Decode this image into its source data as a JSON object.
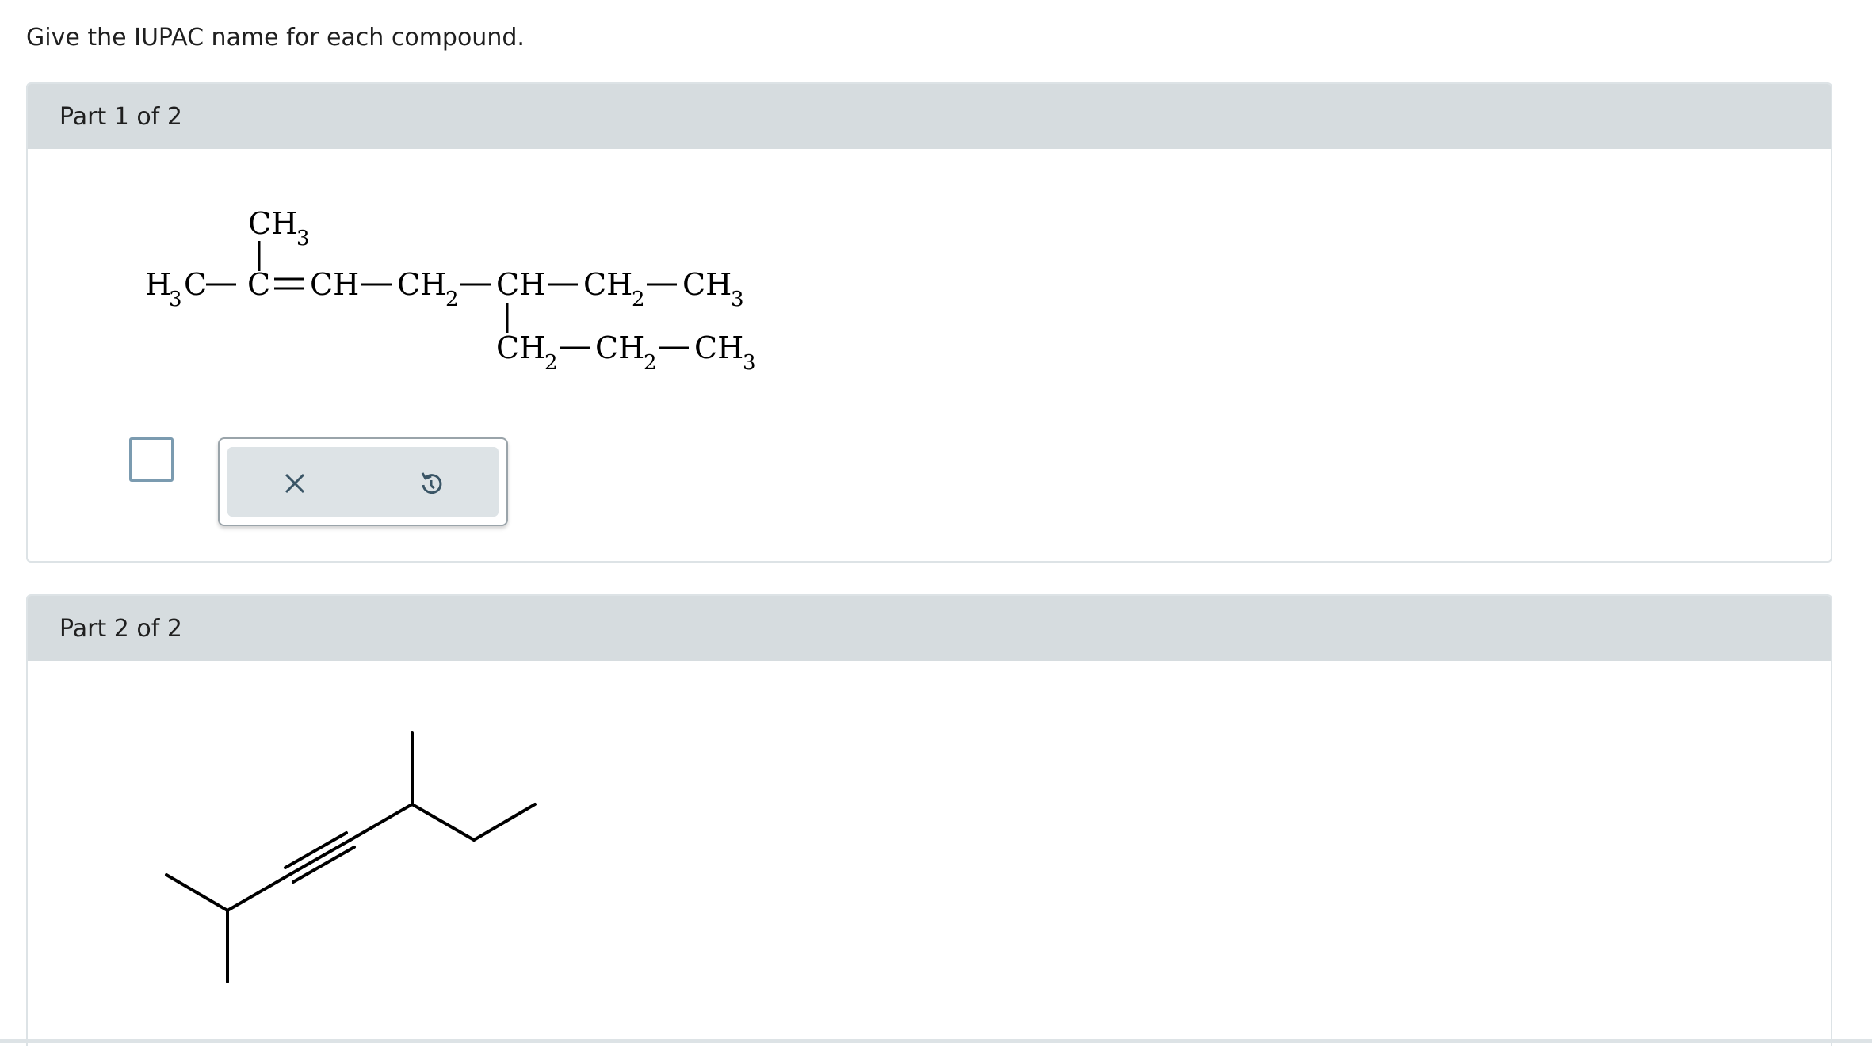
{
  "instructions": "Give the IUPAC name for each compound.",
  "parts": [
    {
      "header": "Part 1 of 2",
      "formula": {
        "top_group": "CH",
        "top_sub": "3",
        "main_chain": [
          {
            "text": "H",
            "sub": "3"
          },
          {
            "text": "C"
          },
          {
            "text": "—C"
          },
          {
            "text": "=CH"
          },
          {
            "text": "—CH",
            "sub": "2"
          },
          {
            "text": "—CH"
          },
          {
            "text": "—CH",
            "sub": "2"
          },
          {
            "text": "—CH",
            "sub": "3"
          }
        ],
        "branch_chain": [
          {
            "text": "CH",
            "sub": "2"
          },
          {
            "text": "—CH",
            "sub": "2"
          },
          {
            "text": "—CH",
            "sub": "3"
          }
        ]
      },
      "answer": {
        "value": "",
        "clear_icon": "close-icon",
        "undo_icon": "undo-icon"
      }
    },
    {
      "header": "Part 2 of 2",
      "structure": "skeletal-formula"
    }
  ],
  "colors": {
    "header_bg": "#d6dcdf",
    "border": "#dde3e6",
    "checkbox_border": "#7b9bb0",
    "icon": "#3a5566"
  }
}
